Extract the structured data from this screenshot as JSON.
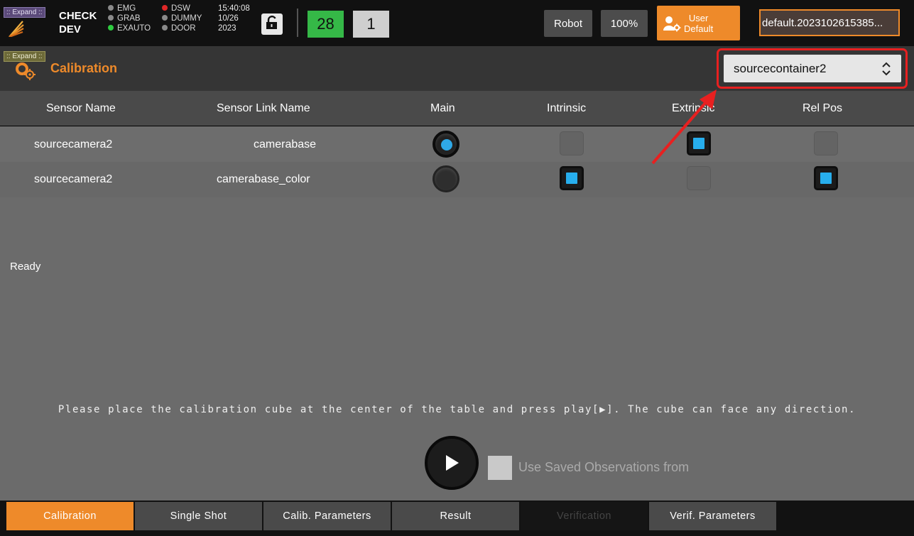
{
  "topbar": {
    "expand_label": ":: Expand ::",
    "brand_line1": "CHECK",
    "brand_line2": "DEV",
    "status": [
      {
        "label": "EMG",
        "color": "#8a8a8a"
      },
      {
        "label": "DSW",
        "color": "#e02727"
      },
      {
        "label": "GRAB",
        "color": "#8a8a8a"
      },
      {
        "label": "DUMMY",
        "color": "#8a8a8a"
      },
      {
        "label": "EXAUTO",
        "color": "#2ecc40"
      },
      {
        "label": "DOOR",
        "color": "#8a8a8a"
      }
    ],
    "time": "15:40:08",
    "date": "10/26",
    "year": "2023",
    "lock_icon": "unlock-icon",
    "counter_green": "28",
    "counter_grey": "1",
    "robot_label": "Robot",
    "speed_label": "100%",
    "user_line1": "User",
    "user_line2": "Default",
    "profile_label": "default.2023102615385..."
  },
  "header": {
    "expand_label": ":: Expand ::",
    "title": "Calibration",
    "container_select": "sourcecontainer2"
  },
  "table": {
    "columns": [
      "Sensor Name",
      "Sensor Link Name",
      "Main",
      "Intrinsic",
      "Extrinsic",
      "Rel Pos"
    ],
    "rows": [
      {
        "sensor_name": "sourcecamera2",
        "link_name": "camerabase",
        "main": true,
        "intrinsic": false,
        "extrinsic": true,
        "rel_pos": false
      },
      {
        "sensor_name": "sourcecamera2",
        "link_name": "camerabase_color",
        "main": false,
        "intrinsic": true,
        "extrinsic": false,
        "rel_pos": true
      }
    ]
  },
  "status_text": "Ready",
  "instruction": "Please place the calibration cube at the center of the table and press play[▶]. The cube can face any direction.",
  "use_saved_label": "Use Saved Observations from",
  "tabs": [
    {
      "label": "Calibration",
      "active": true,
      "disabled": false
    },
    {
      "label": "Single Shot",
      "active": false,
      "disabled": false
    },
    {
      "label": "Calib. Parameters",
      "active": false,
      "disabled": false
    },
    {
      "label": "Result",
      "active": false,
      "disabled": false
    },
    {
      "label": "Verification",
      "active": false,
      "disabled": true
    },
    {
      "label": "Verif. Parameters",
      "active": false,
      "disabled": false
    }
  ],
  "colors": {
    "accent": "#ee8a2a",
    "check_on": "#27aeed",
    "highlight": "#e82020"
  }
}
